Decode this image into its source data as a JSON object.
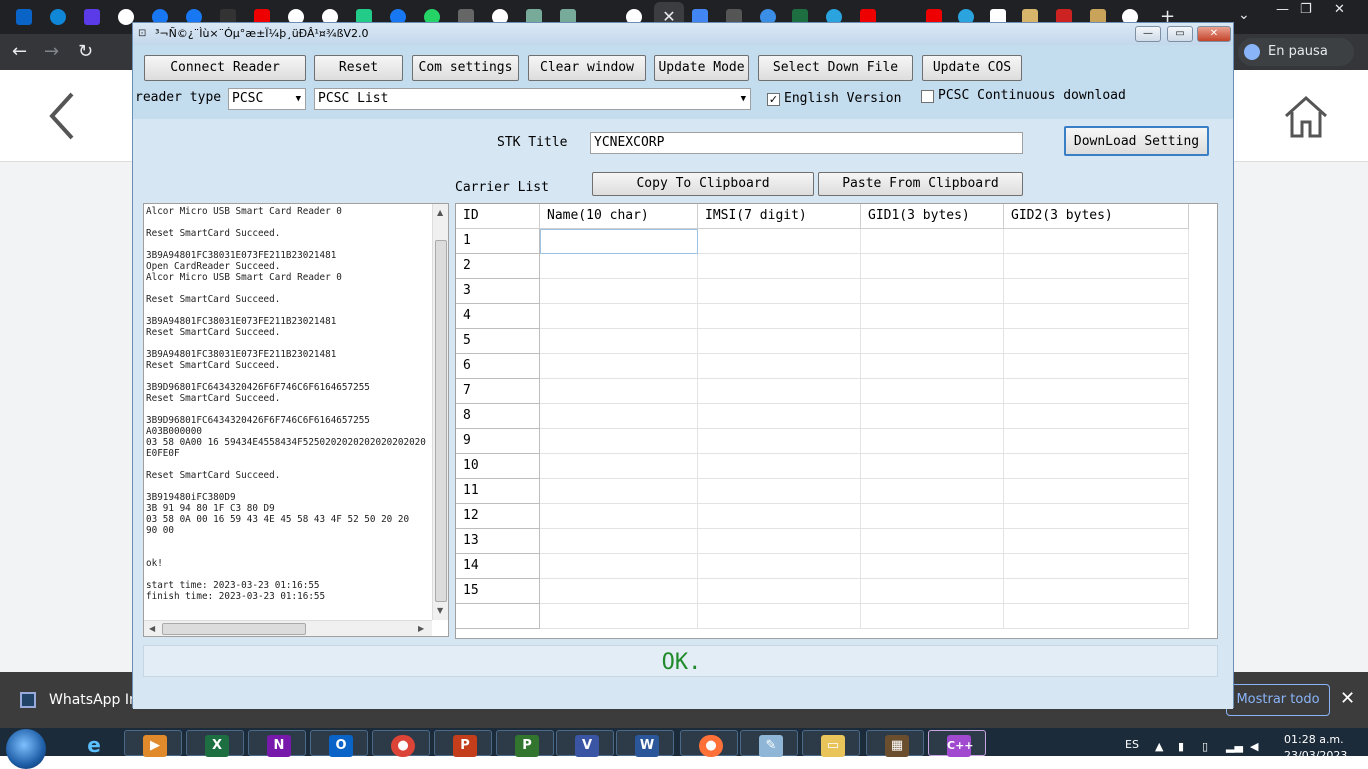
{
  "window": {
    "title": "³¬Ñ©¿¨Ìù×¨Óµ°æ±Ï¼þ¸üÐÂ¹¤¾ßV2.0",
    "toolbar": {
      "connect_reader": "Connect Reader",
      "reset": "Reset",
      "com_settings": "Com settings",
      "clear_window": "Clear window",
      "update_mode": "Update Mode",
      "select_down_file": "Select Down File",
      "update_cos": "Update COS"
    },
    "reader_type_label": "reader type",
    "reader_type_value": "PCSC",
    "reader_list_value": "PCSC List",
    "english_version_label": "English Version",
    "english_version_checked": true,
    "pcsc_continuous_label": "PCSC Continuous download",
    "pcsc_continuous_checked": false,
    "stk_title_label": "STK Title",
    "stk_title_value": "YCNEXCORP",
    "download_setting": "DownLoad Setting",
    "carrier_list_label": "Carrier List",
    "copy_to_clipboard": "Copy To Clipboard",
    "paste_from_clipboard": "Paste From Clipboard",
    "log_lines": [
      "Alcor Micro USB Smart Card Reader 0",
      "",
      "Reset SmartCard Succeed.",
      "",
      "3B9A94801FC38031E073FE211B23021481",
      "Open CardReader Succeed.",
      "Alcor Micro USB Smart Card Reader 0",
      "",
      "Reset SmartCard Succeed.",
      "",
      "3B9A94801FC38031E073FE211B23021481",
      "Reset SmartCard Succeed.",
      "",
      "3B9A94801FC38031E073FE211B23021481",
      "Reset SmartCard Succeed.",
      "",
      "3B9D96801FC6434320426F6F746C6F6164657255",
      "Reset SmartCard Succeed.",
      "",
      "3B9D96801FC6434320426F6F746C6F6164657255",
      "A03B000000",
      "03 58 0A00 16 59434E4558434F5250202020202020202020",
      "E0FE0F",
      "",
      "Reset SmartCard Succeed.",
      "",
      "3B919480iFC380D9",
      "3B 91 94 80 1F C3 80 D9",
      "03 58 0A 00 16 59 43 4E 45 58 43 4F 52 50 20 20",
      "90 00",
      "",
      "",
      "ok!",
      "",
      "start time: 2023-03-23 01:16:55",
      "finish time: 2023-03-23 01:16:55"
    ],
    "grid": {
      "columns": [
        "ID",
        "Name(10 char)",
        "IMSI(7 digit)",
        "GID1(3 bytes)",
        "GID2(3 bytes)"
      ],
      "rows": [
        "1",
        "2",
        "3",
        "4",
        "5",
        "6",
        "7",
        "8",
        "9",
        "10",
        "11",
        "12",
        "13",
        "14",
        "15"
      ]
    },
    "status_text": "OK."
  },
  "browser": {
    "pause_label": "En pausa",
    "download_item": "WhatsApp Ima",
    "show_all": "Mostrar todo"
  },
  "taskbar": {
    "language": "ES",
    "time": "01:28 a.m.",
    "date": "23/03/2023"
  },
  "colors": {
    "window_bg": "#b9d3e8",
    "panel_bg": "#d6e6f3",
    "status_ok": "#1f8b2a",
    "browser_dark": "#202124"
  }
}
